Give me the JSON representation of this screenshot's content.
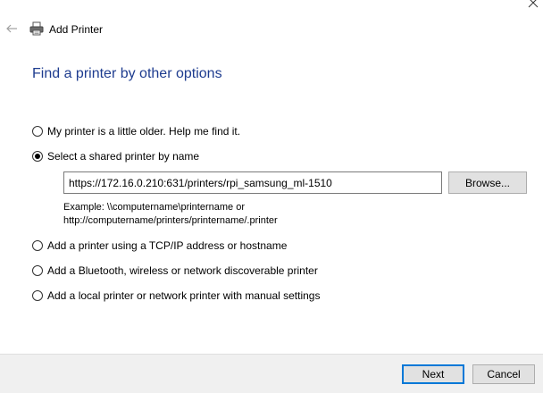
{
  "window": {
    "title": "Add Printer"
  },
  "page": {
    "title": "Find a printer by other options"
  },
  "options": [
    {
      "label": "My printer is a little older. Help me find it.",
      "selected": false
    },
    {
      "label": "Select a shared printer by name",
      "selected": true
    },
    {
      "label": "Add a printer using a TCP/IP address or hostname",
      "selected": false
    },
    {
      "label": "Add a Bluetooth, wireless or network discoverable printer",
      "selected": false
    },
    {
      "label": "Add a local printer or network printer with manual settings",
      "selected": false
    }
  ],
  "shared_printer": {
    "value": "https://172.16.0.210:631/printers/rpi_samsung_ml-1510",
    "browse_label": "Browse...",
    "example_line1": "Example: \\\\computername\\printername or",
    "example_line2": "http://computername/printers/printername/.printer"
  },
  "footer": {
    "next_label": "Next",
    "cancel_label": "Cancel"
  },
  "colors": {
    "title": "#1e3c8f",
    "footer_background": "#f0f0f0",
    "default_button_border": "#0078d7"
  }
}
